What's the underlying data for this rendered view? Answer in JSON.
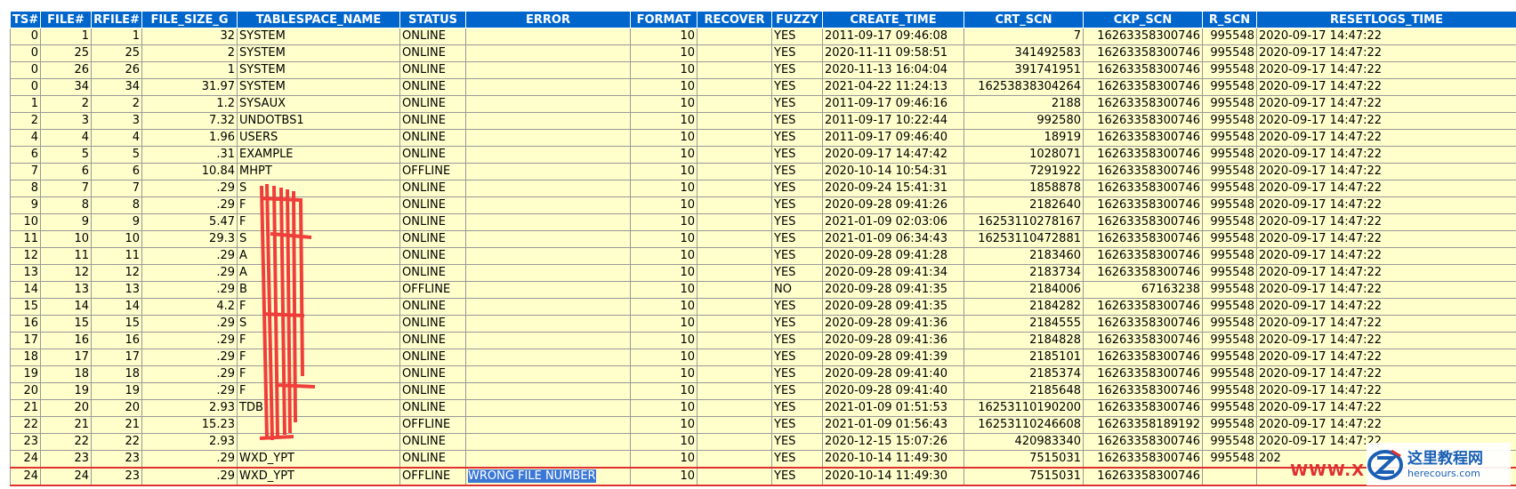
{
  "table": {
    "columns": [
      "TS#",
      "FILE#",
      "RFILE#",
      "FILE_SIZE_G",
      "TABLESPACE_NAME",
      "STATUS",
      "ERROR",
      "FORMAT",
      "RECOVER",
      "FUZZY",
      "CREATE_TIME",
      "CRT_SCN",
      "CKP_SCN",
      "R_SCN",
      "RESETLOGS_TIME"
    ],
    "rows": [
      [
        "0",
        "1",
        "1",
        "32",
        "SYSTEM",
        "ONLINE",
        "",
        "10",
        "",
        "YES",
        "2011-09-17 09:46:08",
        "7",
        "16263358300746",
        "995548",
        "2020-09-17 14:47:22"
      ],
      [
        "0",
        "25",
        "25",
        "2",
        "SYSTEM",
        "ONLINE",
        "",
        "10",
        "",
        "YES",
        "2020-11-11 09:58:51",
        "341492583",
        "16263358300746",
        "995548",
        "2020-09-17 14:47:22"
      ],
      [
        "0",
        "26",
        "26",
        "1",
        "SYSTEM",
        "ONLINE",
        "",
        "10",
        "",
        "YES",
        "2020-11-13 16:04:04",
        "391741951",
        "16263358300746",
        "995548",
        "2020-09-17 14:47:22"
      ],
      [
        "0",
        "34",
        "34",
        "31.97",
        "SYSTEM",
        "ONLINE",
        "",
        "10",
        "",
        "YES",
        "2021-04-22 11:24:13",
        "16253838304264",
        "16263358300746",
        "995548",
        "2020-09-17 14:47:22"
      ],
      [
        "1",
        "2",
        "2",
        "1.2",
        "SYSAUX",
        "ONLINE",
        "",
        "10",
        "",
        "YES",
        "2011-09-17 09:46:16",
        "2188",
        "16263358300746",
        "995548",
        "2020-09-17 14:47:22"
      ],
      [
        "2",
        "3",
        "3",
        "7.32",
        "UNDOTBS1",
        "ONLINE",
        "",
        "10",
        "",
        "YES",
        "2011-09-17 10:22:44",
        "992580",
        "16263358300746",
        "995548",
        "2020-09-17 14:47:22"
      ],
      [
        "4",
        "4",
        "4",
        "1.96",
        "USERS",
        "ONLINE",
        "",
        "10",
        "",
        "YES",
        "2011-09-17 09:46:40",
        "18919",
        "16263358300746",
        "995548",
        "2020-09-17 14:47:22"
      ],
      [
        "6",
        "5",
        "5",
        ".31",
        "EXAMPLE",
        "ONLINE",
        "",
        "10",
        "",
        "YES",
        "2020-09-17 14:47:42",
        "1028071",
        "16263358300746",
        "995548",
        "2020-09-17 14:47:22"
      ],
      [
        "7",
        "6",
        "6",
        "10.84",
        "MHPT",
        "OFFLINE",
        "",
        "10",
        "",
        "YES",
        "2020-10-14 10:54:31",
        "7291922",
        "16263358300746",
        "995548",
        "2020-09-17 14:47:22"
      ],
      [
        "8",
        "7",
        "7",
        ".29",
        "S",
        "ONLINE",
        "",
        "10",
        "",
        "YES",
        "2020-09-24 15:41:31",
        "1858878",
        "16263358300746",
        "995548",
        "2020-09-17 14:47:22"
      ],
      [
        "9",
        "8",
        "8",
        ".29",
        "F",
        "ONLINE",
        "",
        "10",
        "",
        "YES",
        "2020-09-28 09:41:26",
        "2182640",
        "16263358300746",
        "995548",
        "2020-09-17 14:47:22"
      ],
      [
        "10",
        "9",
        "9",
        "5.47",
        "F",
        "ONLINE",
        "",
        "10",
        "",
        "YES",
        "2021-01-09 02:03:06",
        "16253110278167",
        "16263358300746",
        "995548",
        "2020-09-17 14:47:22"
      ],
      [
        "11",
        "10",
        "10",
        "29.3",
        "S",
        "ONLINE",
        "",
        "10",
        "",
        "YES",
        "2021-01-09 06:34:43",
        "16253110472881",
        "16263358300746",
        "995548",
        "2020-09-17 14:47:22"
      ],
      [
        "12",
        "11",
        "11",
        ".29",
        "A",
        "ONLINE",
        "",
        "10",
        "",
        "YES",
        "2020-09-28 09:41:28",
        "2183460",
        "16263358300746",
        "995548",
        "2020-09-17 14:47:22"
      ],
      [
        "13",
        "12",
        "12",
        ".29",
        "A",
        "ONLINE",
        "",
        "10",
        "",
        "YES",
        "2020-09-28 09:41:34",
        "2183734",
        "16263358300746",
        "995548",
        "2020-09-17 14:47:22"
      ],
      [
        "14",
        "13",
        "13",
        ".29",
        "B",
        "OFFLINE",
        "",
        "10",
        "",
        "NO",
        "2020-09-28 09:41:35",
        "2184006",
        "67163238",
        "995548",
        "2020-09-17 14:47:22"
      ],
      [
        "15",
        "14",
        "14",
        "4.2",
        "F",
        "ONLINE",
        "",
        "10",
        "",
        "YES",
        "2020-09-28 09:41:35",
        "2184282",
        "16263358300746",
        "995548",
        "2020-09-17 14:47:22"
      ],
      [
        "16",
        "15",
        "15",
        ".29",
        "S",
        "ONLINE",
        "",
        "10",
        "",
        "YES",
        "2020-09-28 09:41:36",
        "2184555",
        "16263358300746",
        "995548",
        "2020-09-17 14:47:22"
      ],
      [
        "17",
        "16",
        "16",
        ".29",
        "F",
        "ONLINE",
        "",
        "10",
        "",
        "YES",
        "2020-09-28 09:41:36",
        "2184828",
        "16263358300746",
        "995548",
        "2020-09-17 14:47:22"
      ],
      [
        "18",
        "17",
        "17",
        ".29",
        "F",
        "ONLINE",
        "",
        "10",
        "",
        "YES",
        "2020-09-28 09:41:39",
        "2185101",
        "16263358300746",
        "995548",
        "2020-09-17 14:47:22"
      ],
      [
        "19",
        "18",
        "18",
        ".29",
        "F",
        "ONLINE",
        "",
        "10",
        "",
        "YES",
        "2020-09-28 09:41:40",
        "2185374",
        "16263358300746",
        "995548",
        "2020-09-17 14:47:22"
      ],
      [
        "20",
        "19",
        "19",
        ".29",
        "F",
        "ONLINE",
        "",
        "10",
        "",
        "YES",
        "2020-09-28 09:41:40",
        "2185648",
        "16263358300746",
        "995548",
        "2020-09-17 14:47:22"
      ],
      [
        "21",
        "20",
        "20",
        "2.93",
        "TDB",
        "ONLINE",
        "",
        "10",
        "",
        "YES",
        "2021-01-09 01:51:53",
        "16253110190200",
        "16263358300746",
        "995548",
        "2020-09-17 14:47:22"
      ],
      [
        "22",
        "21",
        "21",
        "15.23",
        "",
        "OFFLINE",
        "",
        "10",
        "",
        "YES",
        "2021-01-09 01:56:43",
        "16253110246608",
        "16263358189192",
        "995548",
        "2020-09-17 14:47:22"
      ],
      [
        "23",
        "22",
        "22",
        "2.93",
        "",
        "ONLINE",
        "",
        "10",
        "",
        "YES",
        "2020-12-15 15:07:26",
        "420983340",
        "16263358300746",
        "995548",
        "2020-09-17 14:47:22"
      ],
      [
        "24",
        "23",
        "23",
        ".29",
        "WXD_YPT",
        "ONLINE",
        "",
        "10",
        "",
        "YES",
        "2020-10-14 11:49:30",
        "7515031",
        "16263358300746",
        "995548",
        "202"
      ],
      [
        "24",
        "24",
        "23",
        ".29",
        "WXD_YPT",
        "OFFLINE",
        "WRONG FILE NUMBER",
        "10",
        "",
        "YES",
        "2020-10-14 11:49:30",
        "7515031",
        "16263358300746",
        "",
        ""
      ]
    ],
    "highlight_row": 26
  },
  "watermark": {
    "site_cn": "这里教程网",
    "site_url": "herecours.com",
    "red_text": "WWW.X",
    "logo_icon": "z-logo-icon",
    "brand_color": "#1a5fb4",
    "accent_color": "#e03030"
  },
  "colors": {
    "header_bg": "#0066cc",
    "cell_bg": "#ffffcc",
    "highlight": "#e03030"
  }
}
